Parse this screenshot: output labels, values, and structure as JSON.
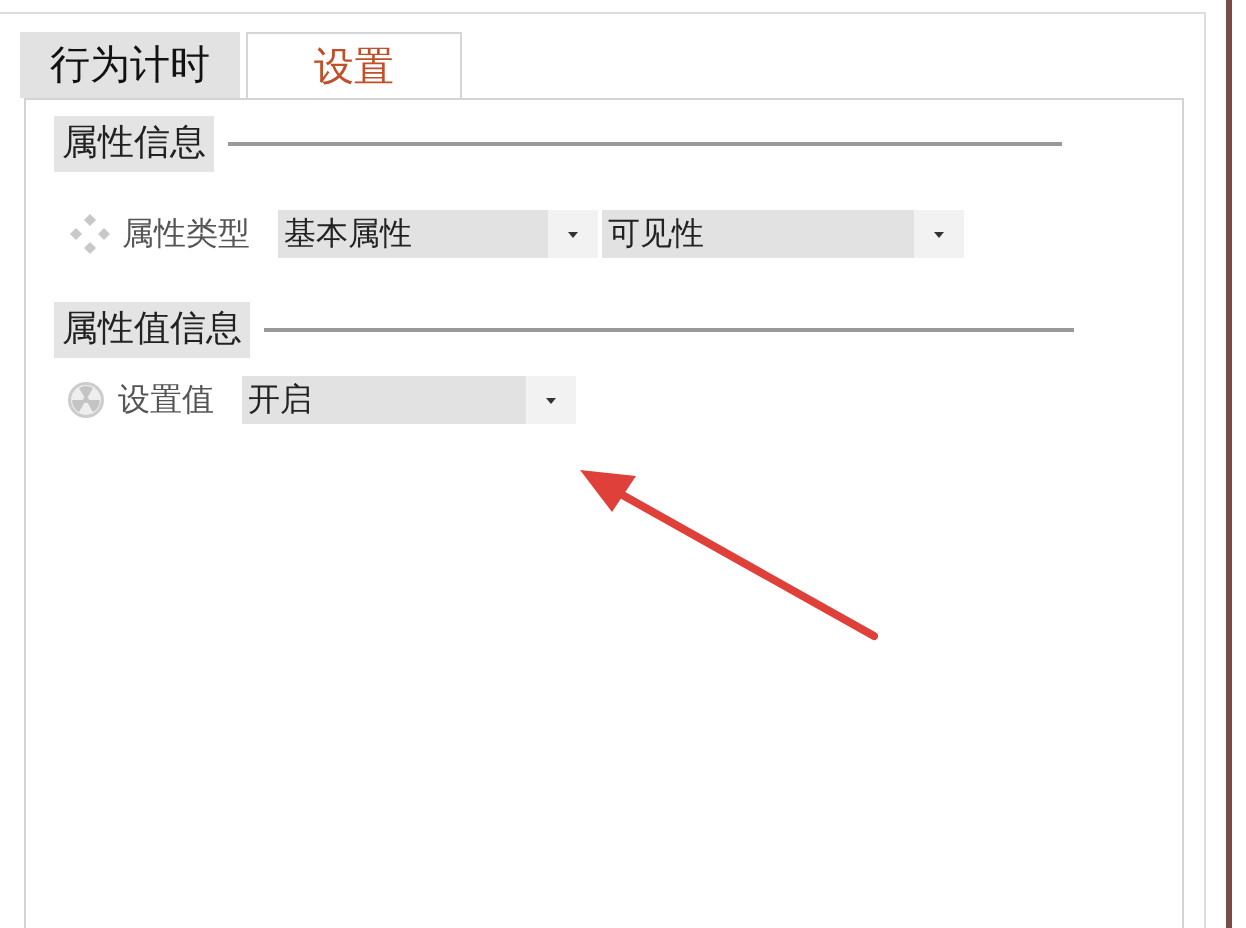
{
  "tabs": [
    {
      "label": "行为计时",
      "selected": false
    },
    {
      "label": "设置",
      "selected": true
    }
  ],
  "sections": [
    {
      "title": "属性信息",
      "rows": [
        {
          "label": "属性类型",
          "dropdowns": [
            {
              "value": "基本属性"
            },
            {
              "value": "可见性"
            }
          ]
        }
      ]
    },
    {
      "title": "属性值信息",
      "rows": [
        {
          "label": "设置值",
          "dropdowns": [
            {
              "value": "开启"
            }
          ]
        }
      ]
    }
  ]
}
